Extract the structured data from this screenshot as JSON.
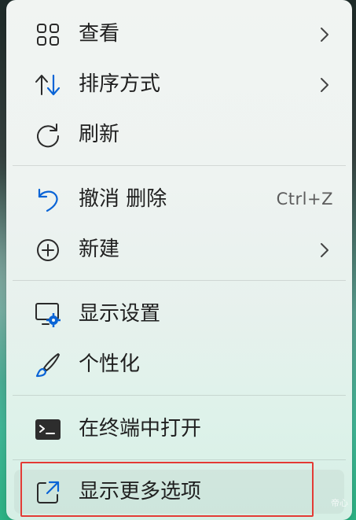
{
  "menu": {
    "items": [
      {
        "label": "查看",
        "icon": "grid-icon"
      },
      {
        "label": "排序方式",
        "icon": "sort-icon"
      },
      {
        "label": "刷新",
        "icon": "refresh-icon"
      },
      {
        "label": "撤消 删除",
        "icon": "undo-icon",
        "shortcut": "Ctrl+Z"
      },
      {
        "label": "新建",
        "icon": "new-icon"
      },
      {
        "label": "显示设置",
        "icon": "display-settings-icon"
      },
      {
        "label": "个性化",
        "icon": "brush-icon"
      },
      {
        "label": "在终端中打开",
        "icon": "terminal-icon"
      },
      {
        "label": "显示更多选项",
        "icon": "more-options-icon"
      }
    ]
  },
  "watermark": "帝心",
  "colors": {
    "accent": "#0a64d6",
    "highlight_border": "#e33b35",
    "text": "#1f1f1f"
  }
}
